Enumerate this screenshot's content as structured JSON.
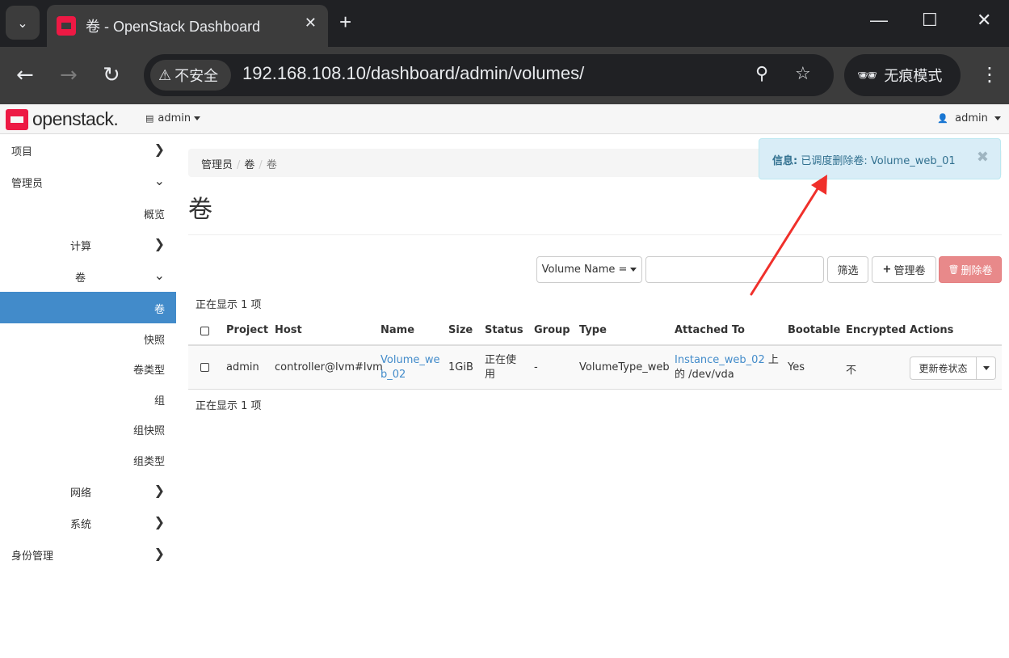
{
  "browser": {
    "tab_title": "卷 - OpenStack Dashboard",
    "tab_close": "✕",
    "new_tab": "+",
    "security_label": "不安全",
    "url": "192.168.108.10/dashboard/admin/volumes/",
    "incognito_label": "无痕模式"
  },
  "header": {
    "logo_text": "openstack.",
    "project": "admin",
    "user": "admin"
  },
  "sidebar": {
    "items": [
      {
        "label": "项目"
      },
      {
        "label": "管理员"
      },
      {
        "label": "概览"
      },
      {
        "label": "计算"
      },
      {
        "label": "卷"
      },
      {
        "label": "卷"
      },
      {
        "label": "快照"
      },
      {
        "label": "卷类型"
      },
      {
        "label": "组"
      },
      {
        "label": "组快照"
      },
      {
        "label": "组类型"
      },
      {
        "label": "网络"
      },
      {
        "label": "系统"
      },
      {
        "label": "身份管理"
      }
    ]
  },
  "breadcrumb": [
    "管理员",
    "卷",
    "卷"
  ],
  "page_title": "卷",
  "alert": {
    "prefix": "信息:",
    "message": "已调度删除卷: Volume_web_01",
    "close": "✖"
  },
  "filter": {
    "field_label": "Volume Name =",
    "input_value": "",
    "filter_button": "筛选",
    "manage_button": "管理卷",
    "delete_button": "删除卷"
  },
  "count_text": "正在显示 1 项",
  "table": {
    "headers": [
      "Project",
      "Host",
      "Name",
      "Size",
      "Status",
      "Group",
      "Type",
      "Attached To",
      "Bootable",
      "Encrypted",
      "Actions"
    ],
    "rows": [
      {
        "project": "admin",
        "host": "controller@lvm#lvm",
        "name_line1": "Volume_we",
        "name_line2": "b_02",
        "size": "1GiB",
        "status_line1": "正在使",
        "status_line2": "用",
        "group": "-",
        "type": "VolumeType_web",
        "attached_instance": "Instance_web_02",
        "attached_suffix": "上",
        "attached_line2": "的 /dev/vda",
        "bootable": "Yes",
        "encrypted": "不",
        "action": "更新卷状态"
      }
    ]
  }
}
